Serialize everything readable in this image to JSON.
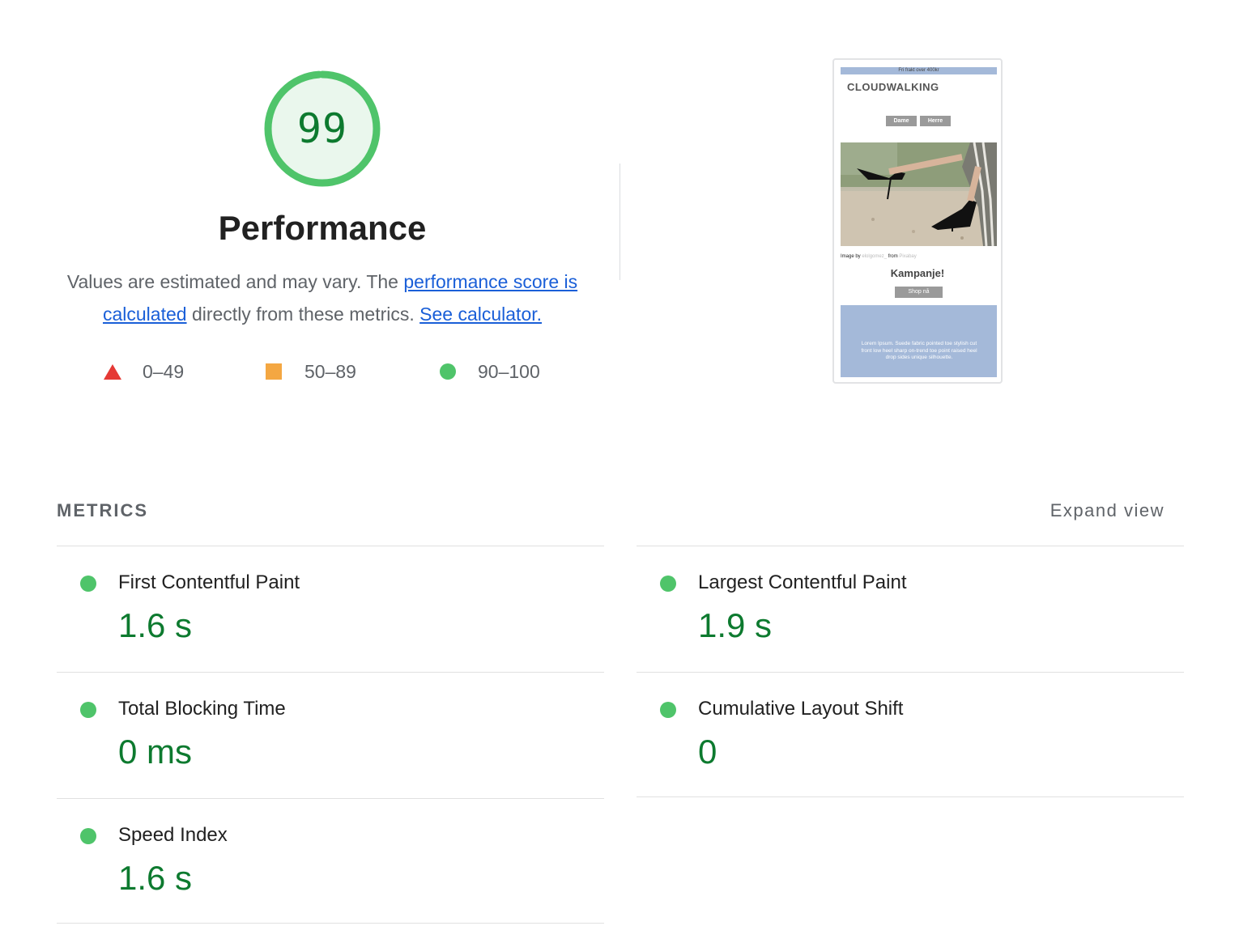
{
  "score": {
    "value": "99",
    "fraction": 0.99,
    "color": "#0d7a2f",
    "ring_color": "#4fc46a",
    "fill_color": "#eaf7ed"
  },
  "title": "Performance",
  "description": {
    "text_before": "Values are estimated and may vary. The ",
    "link1": "performance score is calculated",
    "text_middle": " directly from these metrics. ",
    "link2": "See calculator."
  },
  "legend": [
    {
      "shape": "triangle-icon",
      "color": "#e53935",
      "label": "0–49"
    },
    {
      "shape": "square-icon",
      "color": "#f4a742",
      "label": "50–89"
    },
    {
      "shape": "circle-icon",
      "color": "#4fc46a",
      "label": "90–100"
    }
  ],
  "screenshot": {
    "banner": "Fri frakt over 400kr",
    "brand": "CLOUDWALKING",
    "nav": [
      "Dame",
      "Herre"
    ],
    "credit_prefix": "Image by",
    "credit_author": "elolgomez_",
    "credit_from": "from",
    "credit_source": "Pixabay",
    "headline": "Kampanje!",
    "cta": "Shop nå",
    "footer_text": "Lorem Ipsum. Suede fabric pointed toe stylish cut front low heel sharp on-trend toe point raised heel drop sides unique silhouette."
  },
  "metrics_section": {
    "heading": "METRICS",
    "expand_label": "Expand view",
    "items": [
      {
        "title": "First Contentful Paint",
        "value": "1.6 s",
        "status_color": "#4fc46a"
      },
      {
        "title": "Largest Contentful Paint",
        "value": "1.9 s",
        "status_color": "#4fc46a"
      },
      {
        "title": "Total Blocking Time",
        "value": "0 ms",
        "status_color": "#4fc46a"
      },
      {
        "title": "Cumulative Layout Shift",
        "value": "0",
        "status_color": "#4fc46a"
      },
      {
        "title": "Speed Index",
        "value": "1.6 s",
        "status_color": "#4fc46a"
      }
    ]
  }
}
